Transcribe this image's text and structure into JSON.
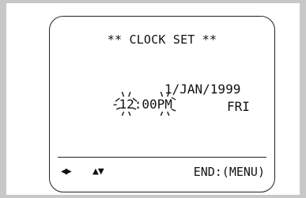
{
  "screen": {
    "title": "** CLOCK SET **",
    "hour": "12",
    "minute_sep": ":00",
    "ampm": "PM",
    "dash": "-",
    "date": "1/JAN/1999",
    "day": "FRI"
  },
  "footer": {
    "left_right_icon": "◀▶",
    "up_down_icon": "▲▼",
    "end_label": "END:(MENU)"
  },
  "colors": {
    "frame": "#c8c8c8",
    "text": "#111111"
  }
}
